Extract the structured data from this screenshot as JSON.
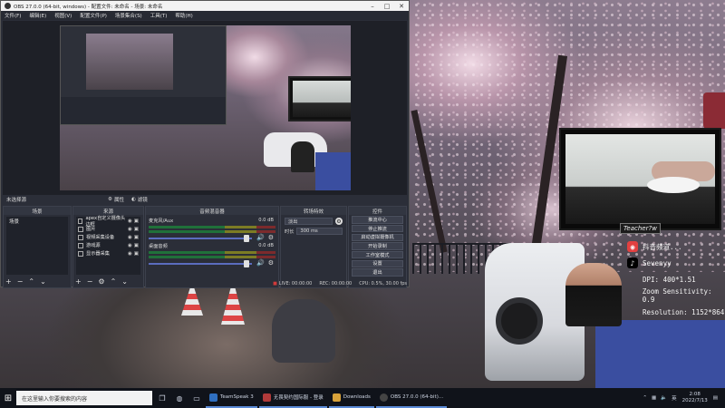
{
  "obs": {
    "title": "OBS 27.0.0 (64-bit, windows) - 配置文件: 未命名 - 场景: 未命名",
    "menu": [
      "文件(F)",
      "编辑(E)",
      "视图(V)",
      "配置文件(P)",
      "场景集合(S)",
      "工具(T)",
      "帮助(H)"
    ],
    "filter_bar": {
      "label": "未选择源",
      "properties": "属性",
      "filters": "滤镜"
    },
    "docks": {
      "scenes": {
        "title": "场景",
        "items": [
          "场景"
        ]
      },
      "sources": {
        "title": "来源",
        "items": [
          "apex自定义摄像头边框",
          "图片",
          "视频采集设备",
          "游戏源",
          "显示器采集"
        ]
      },
      "mixer": {
        "title": "音频混音器",
        "tracks": [
          {
            "name": "麦克风/Aux",
            "db": "0.0 dB",
            "level": 0.97
          },
          {
            "name": "桌面音频",
            "db": "0.0 dB",
            "level": 0.97
          }
        ]
      },
      "transitions": {
        "title": "转场特效",
        "type": "淡出",
        "duration_label": "时长",
        "duration": "300 ms"
      },
      "controls": {
        "title": "控件",
        "buttons": [
          "推流中心",
          "停止推流",
          "启动虚拟摄像机",
          "开始录制",
          "工作室模式",
          "设置",
          "退出"
        ]
      }
    },
    "status": {
      "live": "LIVE: 00:00:00",
      "rec": "REC: 00:00:00",
      "cpu": "CPU: 0.5%, 30.00 fps"
    }
  },
  "overlay": {
    "tag": "Teacher?w",
    "rows": [
      {
        "icon": "weibo-icon",
        "text": "抖音频道..."
      },
      {
        "icon": "tiktok-icon",
        "text": "Sevenyy"
      },
      {
        "icon": "dpi-icon",
        "text": "DPI: 400*1.51"
      },
      {
        "icon": "zoom-icon",
        "text": "Zoom Sensitivity: 0.9"
      },
      {
        "icon": "res-icon",
        "text": "Resolution: 1152*864"
      }
    ]
  },
  "taskbar": {
    "search_placeholder": "在这里输入你要搜索的内容",
    "apps": [
      {
        "label": "TeamSpeak 3",
        "color": "#2f6fc0"
      },
      {
        "label": "无畏契约国际服 - 登录",
        "color": "#b03a3a"
      },
      {
        "label": "Downloads",
        "color": "#d8a23a"
      },
      {
        "label": "OBS 27.0.0 (64-bit)...",
        "color": "#444444"
      }
    ],
    "clock_time": "2:08",
    "clock_date": "2022/7/13",
    "lang": "英"
  },
  "colors": {
    "accent": "#5b6dbf",
    "live_red": "#d03a3a"
  }
}
